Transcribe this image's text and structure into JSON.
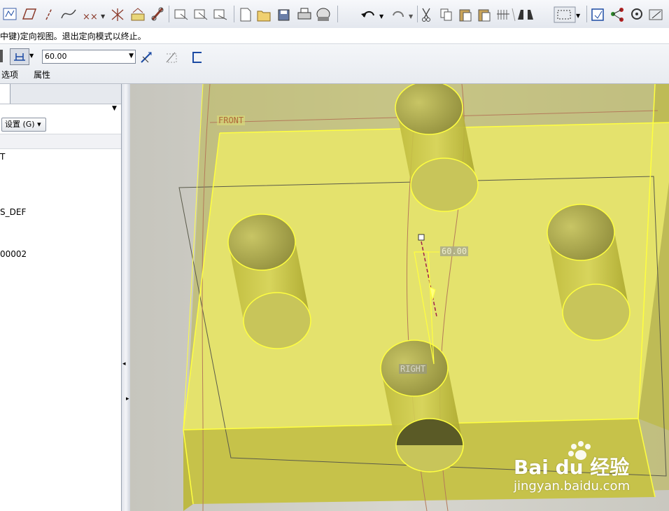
{
  "toolbar": {
    "icons": [
      "sketch-icon",
      "plane-icon",
      "axis-icon",
      "curve-icon",
      "point-icon",
      "csys-icon",
      "analysis-icon",
      "link-icon",
      "view-icon",
      "view2-icon",
      "view3-icon",
      "new-icon",
      "open-icon",
      "save-icon",
      "print-icon",
      "email-icon",
      "undo-icon",
      "redo-icon",
      "cut-icon",
      "copy-icon",
      "paste-icon",
      "paste-special-icon",
      "regenerate-icon",
      "find-icon",
      "select-box-icon",
      "model-tree-icon",
      "relations-icon",
      "settings-icon"
    ]
  },
  "message": {
    "text": "中键)定向视图。退出定向模式以终止。"
  },
  "dashboard": {
    "depth_value": "60.00",
    "tabs": [
      "选项",
      "属性"
    ]
  },
  "leftpanel": {
    "settings_label": "设置 (G) ▾",
    "tree_items": [
      "T",
      "S_DEF",
      "00002"
    ]
  },
  "viewport": {
    "labels": {
      "front": "FRONT",
      "right": "RIGHT",
      "dimension": "60.00"
    },
    "colors": {
      "background": "#c9c8c0",
      "part_fill": "#e8e86a",
      "edge": "#ffff40",
      "datum": "#b47a5a"
    }
  },
  "watermark": {
    "brand": "Bai du 经验",
    "url": "jingyan.baidu.com"
  }
}
